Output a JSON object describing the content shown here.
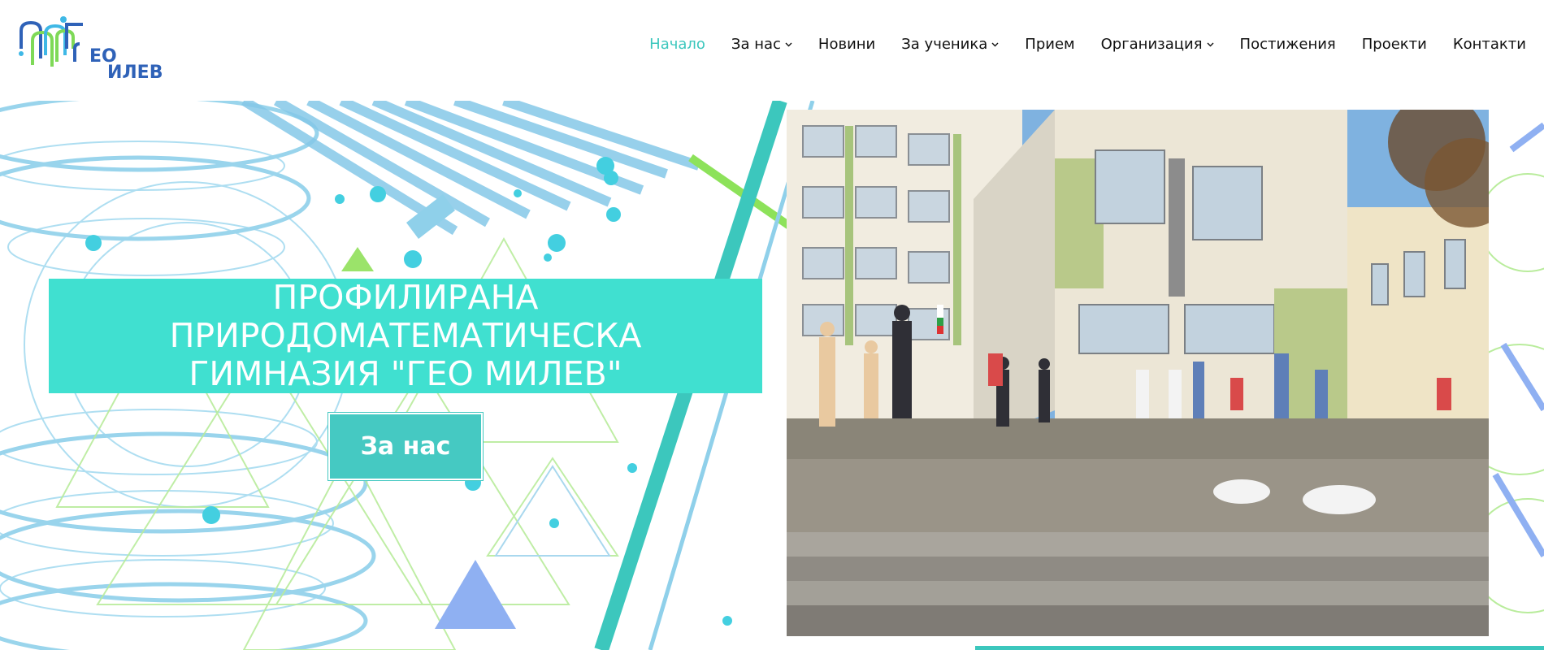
{
  "header": {
    "logo_alt": "ПМГ Гео Милев",
    "logo_line1": "ЕО",
    "logo_line2": "ИЛЕВ"
  },
  "nav": {
    "items": [
      {
        "label": "Начало",
        "active": true,
        "has_dropdown": false
      },
      {
        "label": "За нас",
        "active": false,
        "has_dropdown": true
      },
      {
        "label": "Новини",
        "active": false,
        "has_dropdown": false
      },
      {
        "label": "За ученика",
        "active": false,
        "has_dropdown": true
      },
      {
        "label": "Прием",
        "active": false,
        "has_dropdown": false
      },
      {
        "label": "Организация",
        "active": false,
        "has_dropdown": true
      },
      {
        "label": "Постижения",
        "active": false,
        "has_dropdown": false
      },
      {
        "label": "Проекти",
        "active": false,
        "has_dropdown": false
      },
      {
        "label": "Контакти",
        "active": false,
        "has_dropdown": false
      }
    ]
  },
  "hero": {
    "title_line1": "ПРОФИЛИРАНА",
    "title_line2": "ПРИРОДОМАТЕМАТИЧЕСКА",
    "title_line3": "ГИМНАЗИЯ \"ГЕО МИЛЕВ\"",
    "cta_label": "За нас",
    "photo_alt": "Students gathered in front of the school building"
  },
  "colors": {
    "accent": "#40e0d0",
    "button": "#45c9c2",
    "nav_active": "#3cc7bd",
    "logo_blue": "#2f62b8",
    "logo_green": "#7ed957"
  },
  "icons": {
    "dropdown": "chevron-down-icon"
  }
}
